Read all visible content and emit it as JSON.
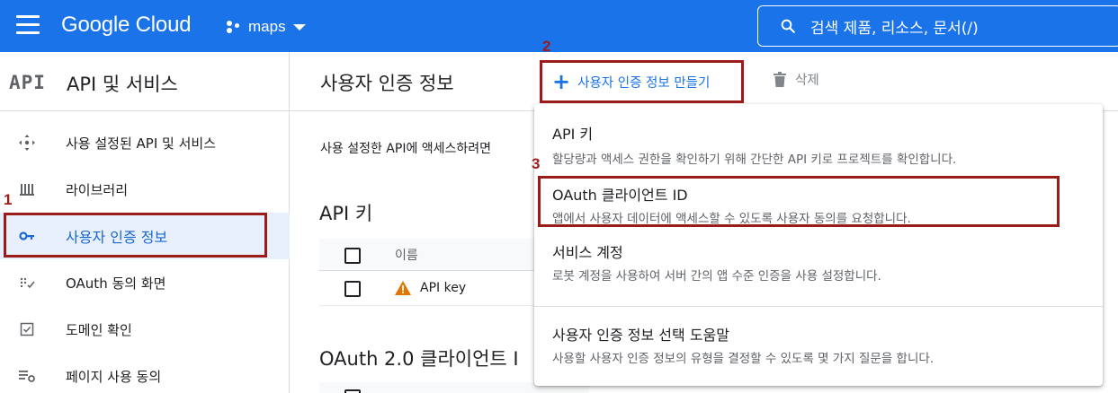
{
  "topbar": {
    "logo": "Google Cloud",
    "project": "maps",
    "search_text": "검색  제품, 리소스, 문서(/)"
  },
  "sidebar": {
    "badge": "API",
    "title": "API 및 서비스",
    "items": [
      {
        "label": "사용 설정된 API 및 서비스",
        "icon": "api-hub-icon"
      },
      {
        "label": "라이브러리",
        "icon": "library-icon"
      },
      {
        "label": "사용자 인증 정보",
        "icon": "key-icon",
        "active": true
      },
      {
        "label": "OAuth 동의 화면",
        "icon": "consent-icon"
      },
      {
        "label": "도메인 확인",
        "icon": "checkbox-icon"
      },
      {
        "label": "페이지 사용 동의",
        "icon": "settings-list-icon"
      }
    ]
  },
  "main": {
    "title": "사용자 인증 정보",
    "create_label": "사용자 인증 정보 만들기",
    "delete_label": "삭제",
    "description": "사용 설정한 API에 액세스하려면",
    "api_keys_title": "API 키",
    "table_header_name": "이름",
    "api_key_row": "API key",
    "oauth_title": "OAuth 2.0 클라이언트 I"
  },
  "menu": {
    "items": [
      {
        "title": "API 키",
        "desc": "할당량과 액세스 권한을 확인하기 위해 간단한 API 키로 프로젝트를 확인합니다."
      },
      {
        "title": "OAuth 클라이언트 ID",
        "desc": "앱에서 사용자 데이터에 액세스할 수 있도록 사용자 동의를 요청합니다."
      },
      {
        "title": "서비스 계정",
        "desc": "로봇 계정을 사용하여 서버 간의 앱 수준 인증을 사용 설정합니다."
      },
      {
        "title": "사용자 인증 정보 선택 도움말",
        "desc": "사용할 사용자 인증 정보의 유형을 결정할 수 있도록 몇 가지 질문을 합니다."
      }
    ]
  },
  "annotations": [
    "1",
    "2",
    "3"
  ],
  "colors": {
    "brand": "#1a73e8",
    "annotation": "#9b1b1b",
    "active_bg": "#e8f0fe"
  }
}
